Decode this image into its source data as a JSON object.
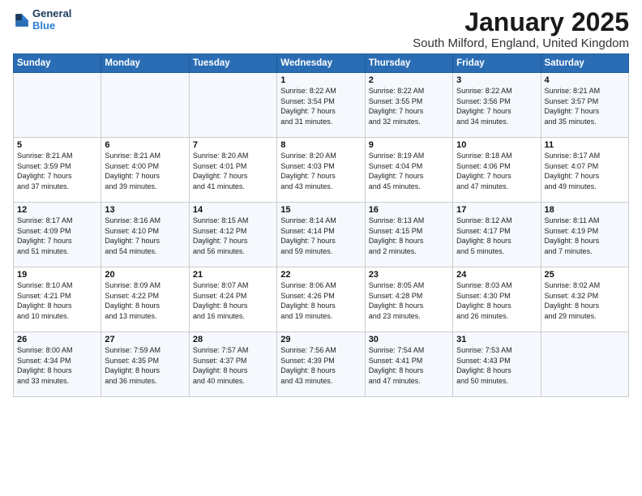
{
  "header": {
    "logo_general": "General",
    "logo_blue": "Blue",
    "month_title": "January 2025",
    "location": "South Milford, England, United Kingdom"
  },
  "days_of_week": [
    "Sunday",
    "Monday",
    "Tuesday",
    "Wednesday",
    "Thursday",
    "Friday",
    "Saturday"
  ],
  "weeks": [
    [
      {
        "day": "",
        "text": ""
      },
      {
        "day": "",
        "text": ""
      },
      {
        "day": "",
        "text": ""
      },
      {
        "day": "1",
        "text": "Sunrise: 8:22 AM\nSunset: 3:54 PM\nDaylight: 7 hours\nand 31 minutes."
      },
      {
        "day": "2",
        "text": "Sunrise: 8:22 AM\nSunset: 3:55 PM\nDaylight: 7 hours\nand 32 minutes."
      },
      {
        "day": "3",
        "text": "Sunrise: 8:22 AM\nSunset: 3:56 PM\nDaylight: 7 hours\nand 34 minutes."
      },
      {
        "day": "4",
        "text": "Sunrise: 8:21 AM\nSunset: 3:57 PM\nDaylight: 7 hours\nand 35 minutes."
      }
    ],
    [
      {
        "day": "5",
        "text": "Sunrise: 8:21 AM\nSunset: 3:59 PM\nDaylight: 7 hours\nand 37 minutes."
      },
      {
        "day": "6",
        "text": "Sunrise: 8:21 AM\nSunset: 4:00 PM\nDaylight: 7 hours\nand 39 minutes."
      },
      {
        "day": "7",
        "text": "Sunrise: 8:20 AM\nSunset: 4:01 PM\nDaylight: 7 hours\nand 41 minutes."
      },
      {
        "day": "8",
        "text": "Sunrise: 8:20 AM\nSunset: 4:03 PM\nDaylight: 7 hours\nand 43 minutes."
      },
      {
        "day": "9",
        "text": "Sunrise: 8:19 AM\nSunset: 4:04 PM\nDaylight: 7 hours\nand 45 minutes."
      },
      {
        "day": "10",
        "text": "Sunrise: 8:18 AM\nSunset: 4:06 PM\nDaylight: 7 hours\nand 47 minutes."
      },
      {
        "day": "11",
        "text": "Sunrise: 8:17 AM\nSunset: 4:07 PM\nDaylight: 7 hours\nand 49 minutes."
      }
    ],
    [
      {
        "day": "12",
        "text": "Sunrise: 8:17 AM\nSunset: 4:09 PM\nDaylight: 7 hours\nand 51 minutes."
      },
      {
        "day": "13",
        "text": "Sunrise: 8:16 AM\nSunset: 4:10 PM\nDaylight: 7 hours\nand 54 minutes."
      },
      {
        "day": "14",
        "text": "Sunrise: 8:15 AM\nSunset: 4:12 PM\nDaylight: 7 hours\nand 56 minutes."
      },
      {
        "day": "15",
        "text": "Sunrise: 8:14 AM\nSunset: 4:14 PM\nDaylight: 7 hours\nand 59 minutes."
      },
      {
        "day": "16",
        "text": "Sunrise: 8:13 AM\nSunset: 4:15 PM\nDaylight: 8 hours\nand 2 minutes."
      },
      {
        "day": "17",
        "text": "Sunrise: 8:12 AM\nSunset: 4:17 PM\nDaylight: 8 hours\nand 5 minutes."
      },
      {
        "day": "18",
        "text": "Sunrise: 8:11 AM\nSunset: 4:19 PM\nDaylight: 8 hours\nand 7 minutes."
      }
    ],
    [
      {
        "day": "19",
        "text": "Sunrise: 8:10 AM\nSunset: 4:21 PM\nDaylight: 8 hours\nand 10 minutes."
      },
      {
        "day": "20",
        "text": "Sunrise: 8:09 AM\nSunset: 4:22 PM\nDaylight: 8 hours\nand 13 minutes."
      },
      {
        "day": "21",
        "text": "Sunrise: 8:07 AM\nSunset: 4:24 PM\nDaylight: 8 hours\nand 16 minutes."
      },
      {
        "day": "22",
        "text": "Sunrise: 8:06 AM\nSunset: 4:26 PM\nDaylight: 8 hours\nand 19 minutes."
      },
      {
        "day": "23",
        "text": "Sunrise: 8:05 AM\nSunset: 4:28 PM\nDaylight: 8 hours\nand 23 minutes."
      },
      {
        "day": "24",
        "text": "Sunrise: 8:03 AM\nSunset: 4:30 PM\nDaylight: 8 hours\nand 26 minutes."
      },
      {
        "day": "25",
        "text": "Sunrise: 8:02 AM\nSunset: 4:32 PM\nDaylight: 8 hours\nand 29 minutes."
      }
    ],
    [
      {
        "day": "26",
        "text": "Sunrise: 8:00 AM\nSunset: 4:34 PM\nDaylight: 8 hours\nand 33 minutes."
      },
      {
        "day": "27",
        "text": "Sunrise: 7:59 AM\nSunset: 4:35 PM\nDaylight: 8 hours\nand 36 minutes."
      },
      {
        "day": "28",
        "text": "Sunrise: 7:57 AM\nSunset: 4:37 PM\nDaylight: 8 hours\nand 40 minutes."
      },
      {
        "day": "29",
        "text": "Sunrise: 7:56 AM\nSunset: 4:39 PM\nDaylight: 8 hours\nand 43 minutes."
      },
      {
        "day": "30",
        "text": "Sunrise: 7:54 AM\nSunset: 4:41 PM\nDaylight: 8 hours\nand 47 minutes."
      },
      {
        "day": "31",
        "text": "Sunrise: 7:53 AM\nSunset: 4:43 PM\nDaylight: 8 hours\nand 50 minutes."
      },
      {
        "day": "",
        "text": ""
      }
    ]
  ]
}
